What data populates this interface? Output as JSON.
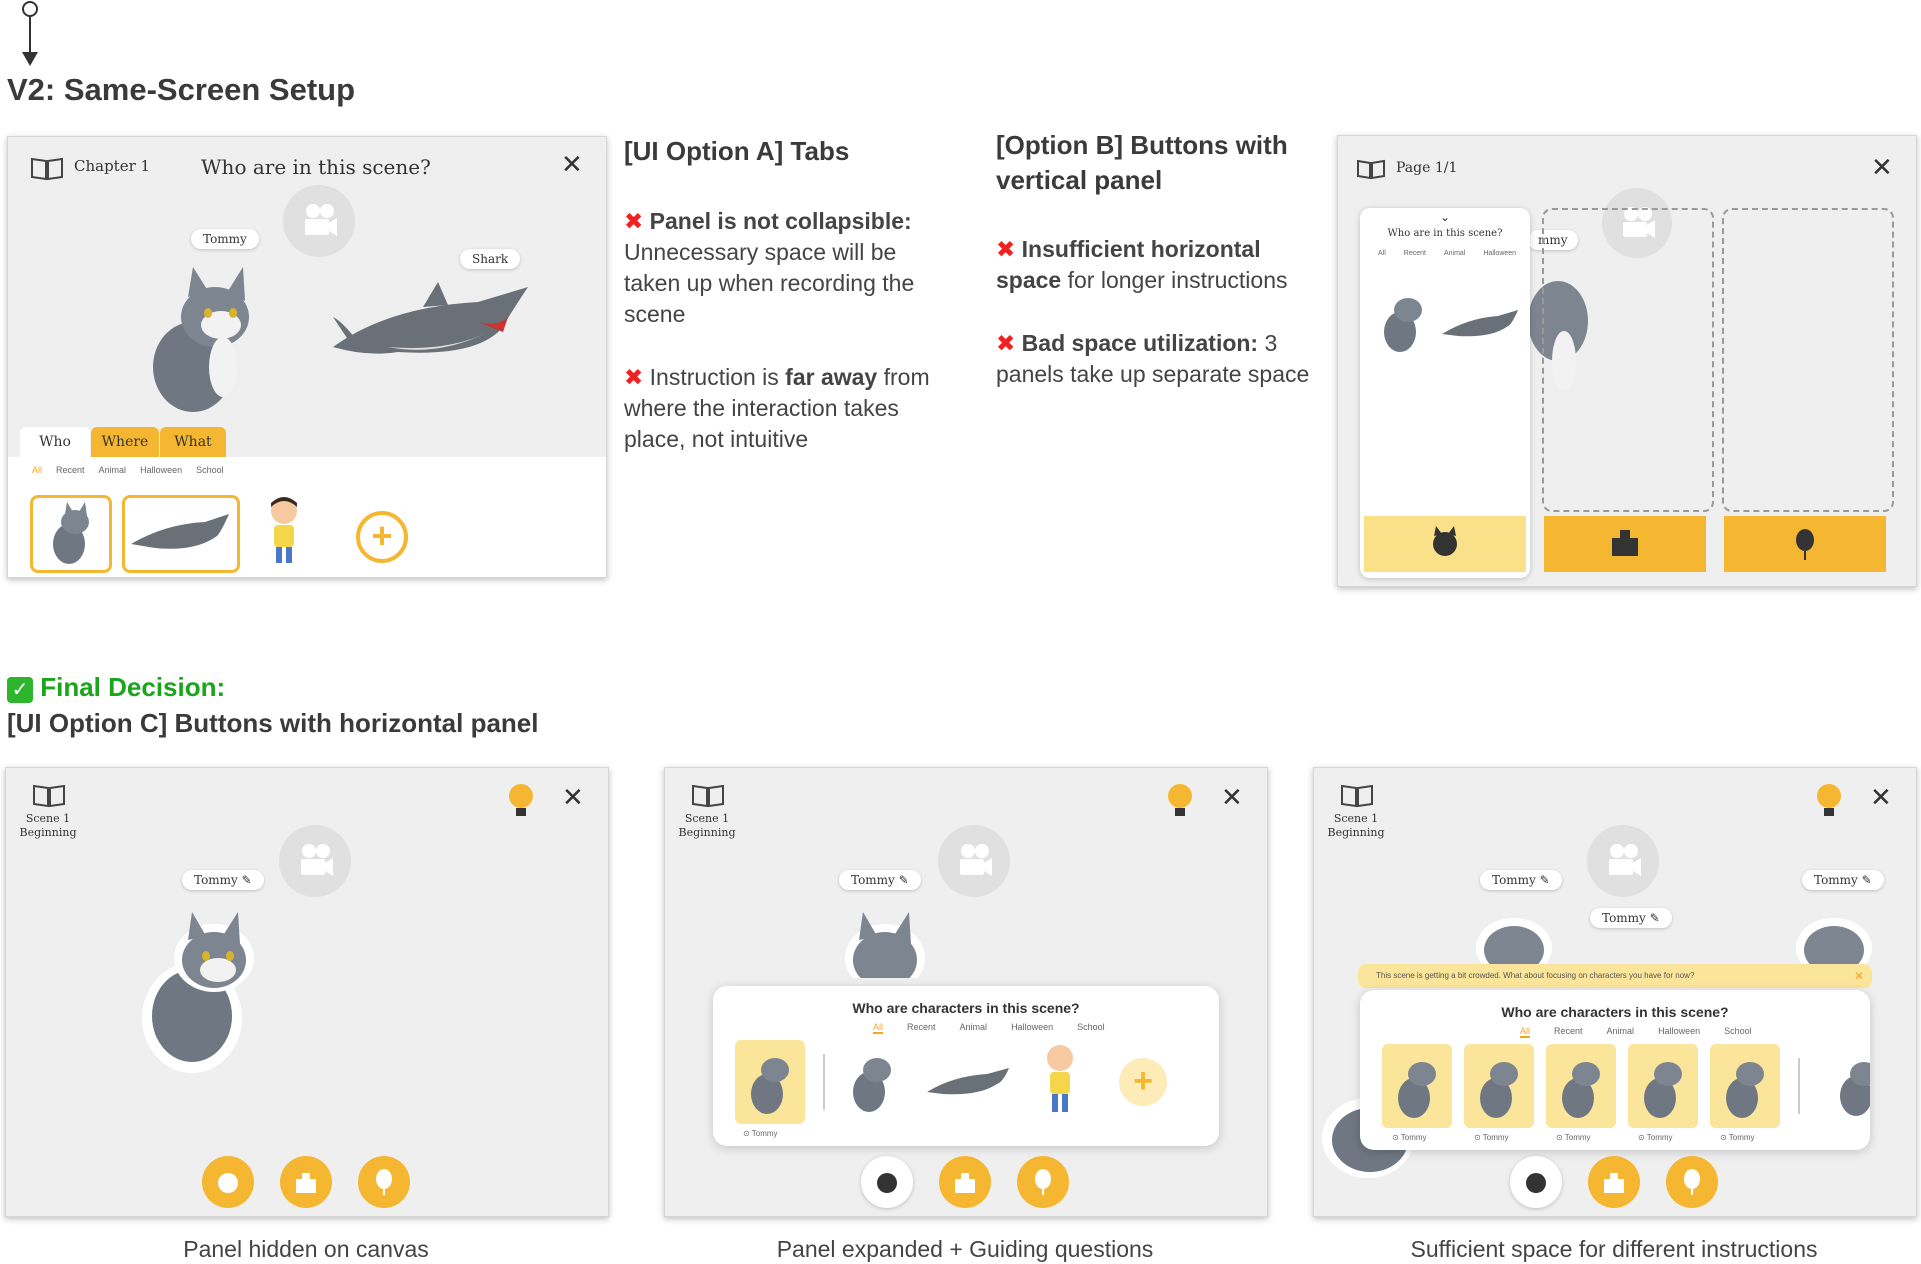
{
  "header": {
    "title": "V2: Same-Screen Setup"
  },
  "optionA": {
    "screen": {
      "chapter": "Chapter 1",
      "question": "Who are in this scene?",
      "tag_tommy": "Tommy",
      "tag_shark": "Shark",
      "tabs": [
        "Who",
        "Where",
        "What"
      ],
      "subtabs": [
        "All",
        "Recent",
        "Animal",
        "Halloween",
        "School"
      ]
    },
    "title": "[UI Option A] Tabs",
    "c1_bold": "Panel is not collapsible:",
    "c1_rest": "Unnecessary space will be taken up when recording the scene",
    "c2_pre": "Instruction is ",
    "c2_bold": "far away",
    "c2_rest": " from where the interaction takes place, not intuitive"
  },
  "optionB": {
    "title": "[Option B] Buttons with vertical panel",
    "c1_bold": "Insufficient horizontal space",
    "c1_rest": " for longer instructions",
    "c2_bold": "Bad space utilization:",
    "c2_rest": " 3 panels take up separate space",
    "screen": {
      "page": "Page 1/1",
      "question": "Who are in this scene?",
      "subtabs": [
        "All",
        "Recent",
        "Animal",
        "Halloween"
      ],
      "tag_partial": "mmy"
    }
  },
  "final": {
    "label": "Final Decision:",
    "subtitle": "[UI Option C] Buttons with horizontal panel"
  },
  "optionC": {
    "scene": "Scene 1",
    "phase": "Beginning",
    "tag": "Tommy",
    "question": "Who are characters in this scene?",
    "subtabs": [
      "All",
      "Recent",
      "Animal",
      "Halloween",
      "School"
    ],
    "thumb_label": "Tommy",
    "warning": "This scene is getting a bit crowded. What about focusing on characters you have for now?",
    "captions": [
      "Panel hidden on canvas",
      "Panel expanded + Guiding questions",
      "Sufficient space for different instructions"
    ]
  },
  "colors": {
    "accent": "#f5b731",
    "light_accent": "#fbe59b",
    "error": "#e22222",
    "success": "#22aa22"
  }
}
